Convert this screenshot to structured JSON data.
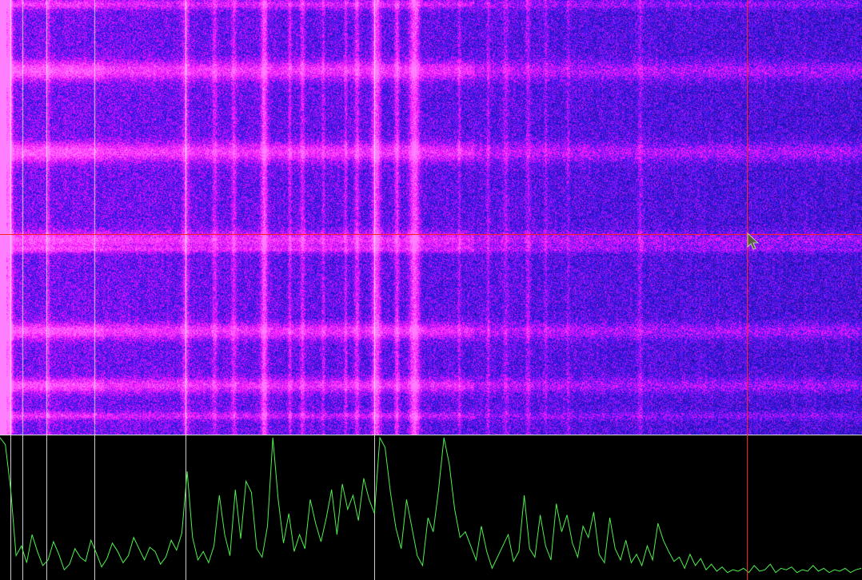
{
  "waterfall": {
    "colors": {
      "floor": "#0d0528",
      "mid": "#2a18ee",
      "high": "#ff12ff",
      "peak": "#ff80ff"
    },
    "marker_color": "#f0f0f0",
    "marker_bins": [
      0.012,
      0.026,
      0.054,
      0.109,
      0.215,
      0.434
    ]
  },
  "spectrum": {
    "background": "#000000",
    "trace_color": "#4ef04e",
    "divider_color": "#d8d8d8",
    "trace": [
      0.99,
      0.94,
      0.62,
      0.15,
      0.22,
      0.1,
      0.3,
      0.18,
      0.08,
      0.12,
      0.25,
      0.16,
      0.05,
      0.09,
      0.2,
      0.14,
      0.11,
      0.26,
      0.17,
      0.07,
      0.13,
      0.24,
      0.18,
      0.1,
      0.15,
      0.28,
      0.2,
      0.12,
      0.21,
      0.18,
      0.09,
      0.14,
      0.26,
      0.19,
      0.31,
      0.75,
      0.28,
      0.12,
      0.18,
      0.1,
      0.22,
      0.58,
      0.3,
      0.15,
      0.62,
      0.27,
      0.68,
      0.6,
      0.2,
      0.14,
      0.36,
      0.99,
      0.55,
      0.24,
      0.45,
      0.18,
      0.3,
      0.2,
      0.55,
      0.38,
      0.25,
      0.42,
      0.62,
      0.3,
      0.66,
      0.48,
      0.58,
      0.4,
      0.7,
      0.55,
      0.45,
      0.99,
      0.92,
      0.6,
      0.35,
      0.2,
      0.55,
      0.35,
      0.15,
      0.08,
      0.42,
      0.32,
      0.62,
      0.99,
      0.8,
      0.48,
      0.28,
      0.32,
      0.22,
      0.12,
      0.36,
      0.18,
      0.06,
      0.14,
      0.22,
      0.3,
      0.11,
      0.18,
      0.58,
      0.2,
      0.14,
      0.44,
      0.22,
      0.12,
      0.52,
      0.32,
      0.44,
      0.24,
      0.14,
      0.36,
      0.28,
      0.46,
      0.16,
      0.1,
      0.42,
      0.2,
      0.12,
      0.26,
      0.1,
      0.16,
      0.08,
      0.22,
      0.12,
      0.38,
      0.26,
      0.18,
      0.11,
      0.14,
      0.06,
      0.16,
      0.08,
      0.13,
      0.05,
      0.09,
      0.04,
      0.07,
      0.03,
      0.05,
      0.04,
      0.06,
      0.03,
      0.08,
      0.04,
      0.05,
      0.09,
      0.03,
      0.06,
      0.05,
      0.07,
      0.03,
      0.05,
      0.04,
      0.08,
      0.04,
      0.06,
      0.03,
      0.05,
      0.04,
      0.06,
      0.03,
      0.05,
      0.06
    ]
  },
  "cursor": {
    "color": "#ff2222"
  }
}
